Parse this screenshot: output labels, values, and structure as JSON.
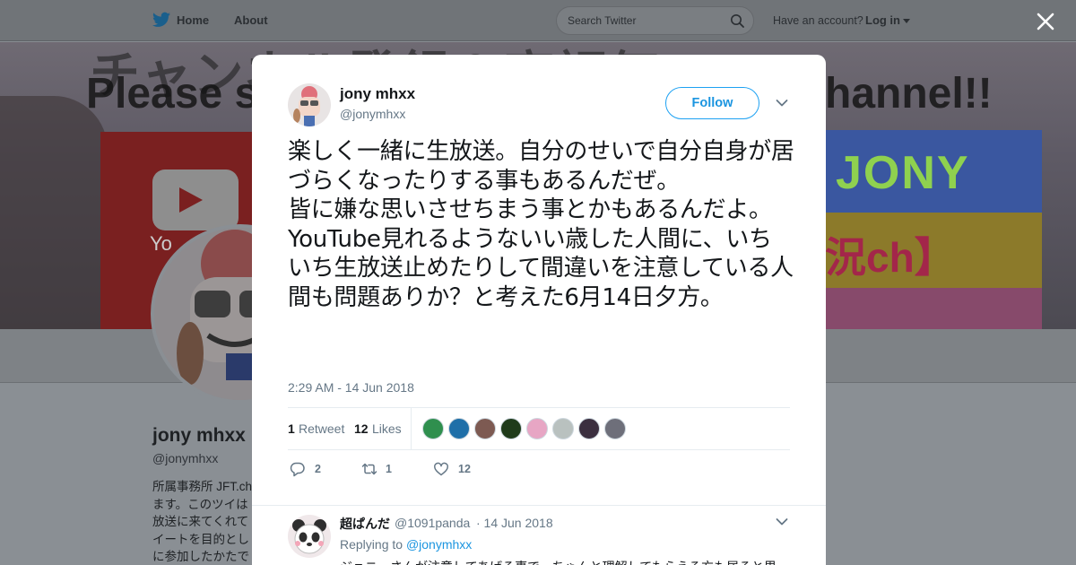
{
  "topbar": {
    "home_label": "Home",
    "about_label": "About",
    "search_placeholder": "Search Twitter",
    "account_prompt": "Have an account?",
    "login_label": "Log in",
    "icons": [
      "twitter-bird-icon",
      "search-icon",
      "caret-down-icon",
      "close-icon"
    ]
  },
  "banner": {
    "line1": "チャンネル登録＆高評価",
    "line2_left": "Please su",
    "line2_right": "hannel!!",
    "youtube_word": "Yo",
    "jony": "JONY",
    "kyo": "況ch】"
  },
  "profile": {
    "name": "jony mhxx",
    "handle": "@jonymhxx",
    "bio": "所属事務所 JFT.ch ます。このツイは 放送に来てくれて イートを目的とし に参加したかたで"
  },
  "tweet": {
    "author_name": "jony mhxx",
    "author_handle": "@jonymhxx",
    "follow_label": "Follow",
    "text": "楽しく一緒に生放送。自分のせいで自分自身が居づらくなったりする事もあるんだぜ。\n皆に嫌な思いさせちまう事とかもあるんだよ。\nYouTube見れるようないい歳した人間に、いちいち生放送止めたりして間違いを注意している人間も問題ありか？と考えた6月14日夕方。",
    "timestamp": "2:29 AM - 14 Jun 2018",
    "retweet_count": "1",
    "retweet_label": "Retweet",
    "like_count": "12",
    "like_label": "Likes",
    "actions": {
      "reply_count": "2",
      "retweet_count": "1",
      "like_count": "12"
    },
    "liker_colors": [
      "#2f8f4e",
      "#1f6fa8",
      "#7d5a52",
      "#1f3b1a",
      "#e7a6c4",
      "#b9c1bf",
      "#3b2f3f",
      "#6e6f7a"
    ]
  },
  "reply": {
    "author_name": "超ぱんだ",
    "author_handle": "@1091panda",
    "date": "· 14 Jun 2018",
    "replying_to_prefix": "Replying to",
    "replying_to_handle": "@jonymhxx",
    "text": "ジョニーさんが注意してあげる事で、ちゃんと理解してもらえる方も居ると思"
  },
  "colors": {
    "accent": "#1da1f2",
    "link": "#1b95e0",
    "text_primary": "#14171a",
    "text_secondary": "#657786",
    "divider": "#e6ecf0"
  }
}
